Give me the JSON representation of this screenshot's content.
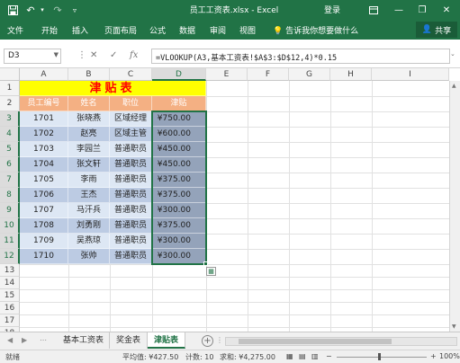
{
  "window": {
    "title": "员工工资表.xlsx - Excel",
    "login": "登录",
    "icons": [
      "save-icon",
      "undo-icon",
      "redo-icon",
      "customize-icon",
      "ribbon-display-icon",
      "minimize-icon",
      "restore-icon",
      "close-icon"
    ]
  },
  "ribbon": {
    "tabs": [
      "文件",
      "开始",
      "插入",
      "页面布局",
      "公式",
      "数据",
      "审阅",
      "视图"
    ],
    "tell_me": "告诉我你想要做什么",
    "share": "共享"
  },
  "formula_bar": {
    "name_box": "D3",
    "formula": "=VLOOKUP(A3,基本工资表!$A$3:$D$12,4)*0.15"
  },
  "columns": [
    "A",
    "B",
    "C",
    "D",
    "E",
    "F",
    "G",
    "H",
    "I"
  ],
  "rows": [
    "1",
    "2",
    "3",
    "4",
    "5",
    "6",
    "7",
    "8",
    "9",
    "10",
    "11",
    "12",
    "13",
    "14",
    "15",
    "16",
    "17",
    "18"
  ],
  "sheet": {
    "title": "津贴表",
    "headers": [
      "员工编号",
      "姓名",
      "职位",
      "津贴"
    ],
    "records": [
      [
        "1701",
        "张晓燕",
        "区域经理",
        "¥750.00"
      ],
      [
        "1702",
        "赵亮",
        "区域主管",
        "¥600.00"
      ],
      [
        "1703",
        "李园兰",
        "普通职员",
        "¥450.00"
      ],
      [
        "1704",
        "张文轩",
        "普通职员",
        "¥450.00"
      ],
      [
        "1705",
        "李雨",
        "普通职员",
        "¥375.00"
      ],
      [
        "1706",
        "王杰",
        "普通职员",
        "¥375.00"
      ],
      [
        "1707",
        "马汗兵",
        "普通职员",
        "¥300.00"
      ],
      [
        "1708",
        "刘勇刚",
        "普通职员",
        "¥375.00"
      ],
      [
        "1709",
        "吴燕琼",
        "普通职员",
        "¥300.00"
      ],
      [
        "1710",
        "张帅",
        "普通职员",
        "¥300.00"
      ]
    ]
  },
  "sheet_tabs": [
    "基本工资表",
    "奖金表",
    "津贴表"
  ],
  "active_sheet": "津贴表",
  "status": {
    "mode": "就绪",
    "average": "平均值: ¥427.50",
    "count": "计数: 10",
    "sum": "求和: ¥4,275.00",
    "zoom": "100%"
  },
  "colors": {
    "excel_green": "#217346",
    "title_fill": "#ffff00",
    "title_text": "#ff0000",
    "header_fill": "#f4b083",
    "band_light": "#dde7f4",
    "band_dark": "#bccbe3",
    "selection_fill": "#94a3ba"
  }
}
